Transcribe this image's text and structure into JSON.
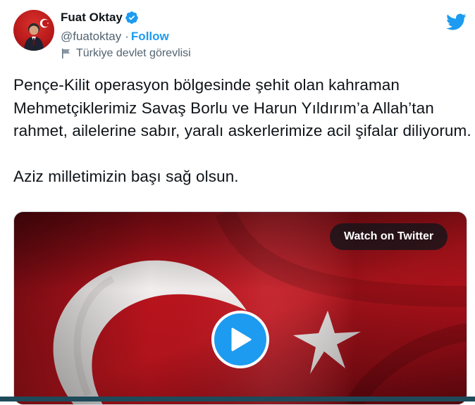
{
  "author": {
    "name": "Fuat Oktay",
    "handle": "@fuatoktay",
    "separator": "·",
    "follow_label": "Follow",
    "account_label": "Türkiye devlet görevlisi"
  },
  "tweet": {
    "text": "Pençe-Kilit operasyon bölgesinde şehit olan kahraman Mehmetçiklerimiz Savaş Borlu ve Harun Yıldırım’a Allah’tan rahmet, ailelerine sabır, yaralı askerlerimize acil şifalar diliyorum.\n\nAziz milletimizin başı sağ olsun."
  },
  "media": {
    "watch_label": "Watch on Twitter"
  },
  "colors": {
    "accent": "#1d9bf0",
    "text": "#0f1419",
    "muted": "#536471",
    "flag_red": "#c8161f"
  },
  "icons": [
    "verified-badge-icon",
    "twitter-bird-icon",
    "government-flag-icon",
    "play-icon"
  ]
}
